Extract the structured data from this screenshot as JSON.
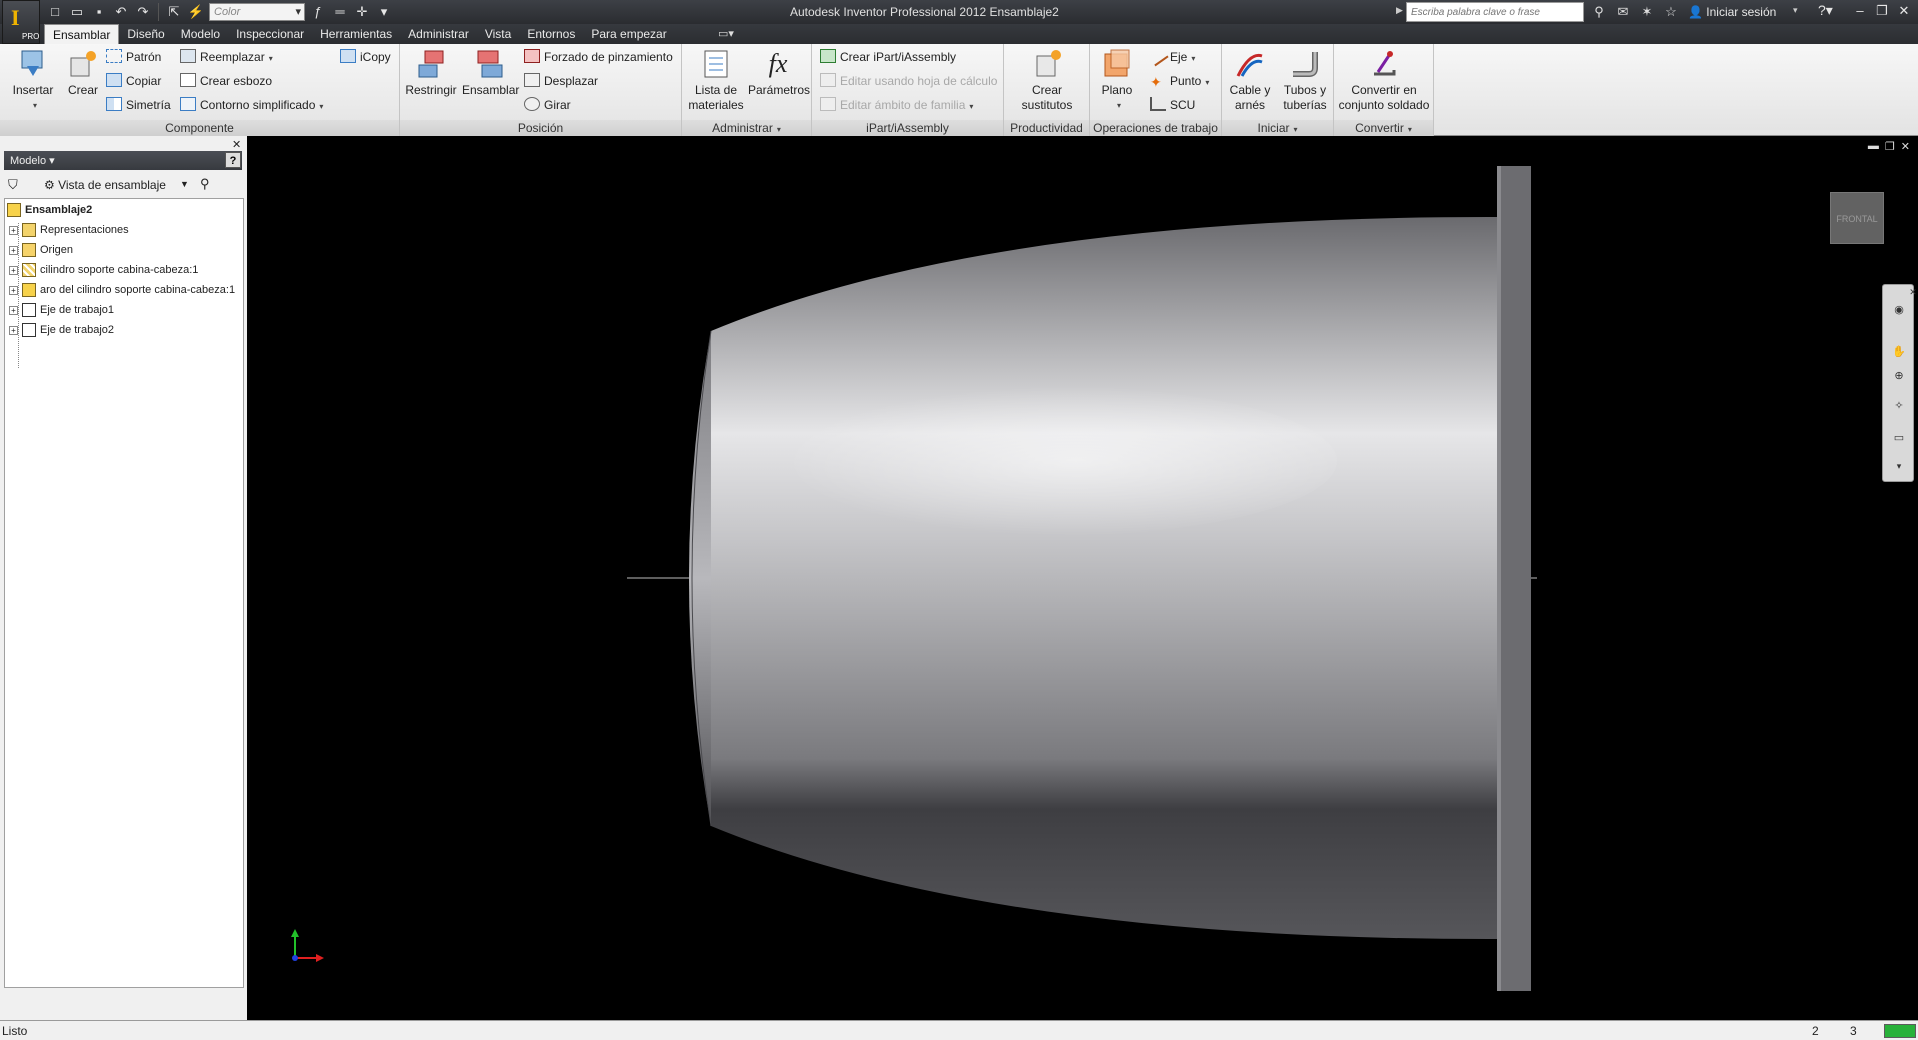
{
  "window": {
    "title": "Autodesk Inventor Professional 2012    Ensamblaje2",
    "app_badge": "PRO",
    "color_combo": "Color",
    "search_placeholder": "Escriba palabra clave o frase",
    "signin": "Iniciar sesión"
  },
  "tabs": [
    "Ensamblar",
    "Diseño",
    "Modelo",
    "Inspeccionar",
    "Herramientas",
    "Administrar",
    "Vista",
    "Entornos",
    "Para empezar"
  ],
  "ribbon": {
    "componente": {
      "title": "Componente",
      "insertar": "Insertar",
      "crear": "Crear",
      "patron": "Patrón",
      "copiar": "Copiar",
      "simetria": "Simetría",
      "reemplazar": "Reemplazar",
      "crear_esbozo": "Crear esbozo",
      "contorno": "Contorno simplificado",
      "icopy": "iCopy"
    },
    "posicion": {
      "title": "Posición",
      "restringir": "Restringir",
      "ensamblar": "Ensamblar",
      "forzado": "Forzado de pinzamiento",
      "desplazar": "Desplazar",
      "girar": "Girar"
    },
    "administrar": {
      "title": "Administrar",
      "lista_1": "Lista de",
      "lista_2": "materiales",
      "parametros": "Parámetros"
    },
    "ipart": {
      "title": "iPart/iAssembly",
      "crear": "Crear iPart/iAssembly",
      "editar": "Editar usando hoja de cálculo",
      "editar_ambito": "Editar ámbito de familia"
    },
    "productividad": {
      "title": "Productividad",
      "crear_1": "Crear",
      "crear_2": "sustitutos"
    },
    "operaciones": {
      "title": "Operaciones de trabajo",
      "plano": "Plano",
      "eje": "Eje",
      "punto": "Punto",
      "scu": "SCU"
    },
    "iniciar": {
      "title": "Iniciar",
      "cable_1": "Cable y",
      "cable_2": "arnés",
      "tubos_1": "Tubos y",
      "tubos_2": "tuberías"
    },
    "convertir": {
      "title": "Convertir",
      "conv_1": "Convertir en",
      "conv_2": "conjunto soldado"
    }
  },
  "browser": {
    "header": "Modelo",
    "view": "Vista de ensamblaje",
    "root": "Ensamblaje2",
    "nodes": [
      "Representaciones",
      "Origen",
      "cilindro soporte cabina-cabeza:1",
      "aro del cilindro soporte cabina-cabeza:1",
      "Eje de trabajo1",
      "Eje de trabajo2"
    ]
  },
  "viewport": {
    "viewcube_label": "FRONTAL"
  },
  "status": {
    "text": "Listo",
    "count_a": "2",
    "count_b": "3"
  }
}
